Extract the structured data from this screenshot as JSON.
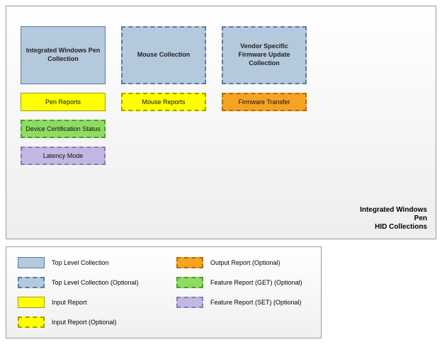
{
  "diagram": {
    "title_line1": "Integrated Windows",
    "title_line2": "Pen",
    "title_line3": "HID Collections",
    "columns": [
      {
        "top": {
          "label": "Integrated Windows Pen Collection",
          "style": "solid-blue"
        },
        "items": [
          {
            "label": "Pen Reports",
            "style": "yellow-solid"
          },
          {
            "label": "Device Certification Status",
            "style": "green-dashed"
          },
          {
            "label": "Latency Mode",
            "style": "purple-dashed"
          }
        ]
      },
      {
        "top": {
          "label": "Mouse Collection",
          "style": "dashed-blue"
        },
        "items": [
          {
            "label": "Mouse Reports",
            "style": "yellow-dashed"
          }
        ]
      },
      {
        "top": {
          "label": "Vendor Specific Firmware Update Collection",
          "style": "dashed-blue"
        },
        "items": [
          {
            "label": "Firmware Transfer",
            "style": "orange-dashed"
          }
        ]
      }
    ]
  },
  "legend": {
    "left": [
      {
        "swatch": "sw-blue-solid",
        "label": "Top Level Collection"
      },
      {
        "swatch": "sw-blue-dashed",
        "label": "Top Level Collection (Optional)"
      },
      {
        "swatch": "sw-yellow-solid",
        "label": "Input Report"
      },
      {
        "swatch": "sw-yellow-dashed",
        "label": "Input Report (Optional)"
      }
    ],
    "right": [
      {
        "swatch": "sw-orange-dashed",
        "label": "Output Report (Optional)"
      },
      {
        "swatch": "sw-green-dashed",
        "label": "Feature Report (GET) (Optional)"
      },
      {
        "swatch": "sw-purple-dashed",
        "label": "Feature Report (SET) (Optional)"
      }
    ]
  }
}
